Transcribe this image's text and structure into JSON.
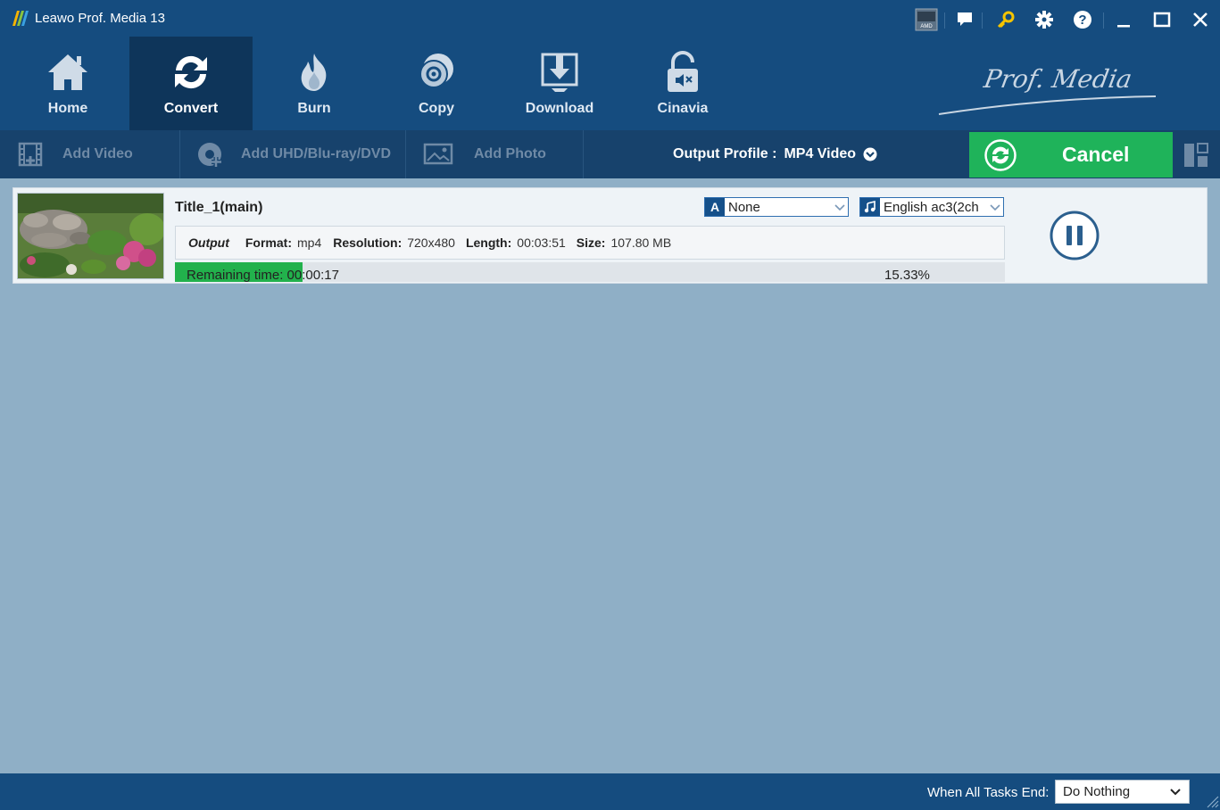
{
  "app": {
    "title": "Leawo Prof. Media 13",
    "brand": "Prof. Media"
  },
  "titlebar": {
    "icons": [
      "amd-icon",
      "chat-icon",
      "key-icon",
      "gear-icon",
      "help-icon",
      "minimize-icon",
      "maximize-icon",
      "close-icon"
    ],
    "amd_label": "AMD"
  },
  "nav": {
    "items": [
      {
        "label": "Home",
        "icon": "home-icon"
      },
      {
        "label": "Convert",
        "icon": "convert-icon",
        "active": true
      },
      {
        "label": "Burn",
        "icon": "burn-icon"
      },
      {
        "label": "Copy",
        "icon": "copy-icon"
      },
      {
        "label": "Download",
        "icon": "download-icon"
      },
      {
        "label": "Cinavia",
        "icon": "cinavia-icon"
      }
    ]
  },
  "toolbar": {
    "add_video": "Add Video",
    "add_disc": "Add UHD/Blu-ray/DVD",
    "add_photo": "Add Photo",
    "output_profile_label": "Output Profile :",
    "output_profile_value": "MP4 Video",
    "cancel": "Cancel"
  },
  "task": {
    "title": "Title_1(main)",
    "subtitle_select": "None",
    "audio_select": "English ac3(2ch",
    "output_label": "Output",
    "format_label": "Format:",
    "format_value": "mp4",
    "resolution_label": "Resolution:",
    "resolution_value": "720x480",
    "length_label": "Length:",
    "length_value": "00:03:51",
    "size_label": "Size:",
    "size_value": "107.80 MB",
    "remaining": "Remaining time: 00:00:17",
    "percent": "15.33%",
    "progress": 0.1533
  },
  "footer": {
    "end_label": "When All Tasks End:",
    "end_value": "Do Nothing"
  },
  "colors": {
    "titlebar": "#154c7f",
    "toolbar": "#17426c",
    "nav_active": "#0e355a",
    "cancel_green": "#1fb35a",
    "progress_green": "#22b14c",
    "workspace": "#8fafc6"
  }
}
